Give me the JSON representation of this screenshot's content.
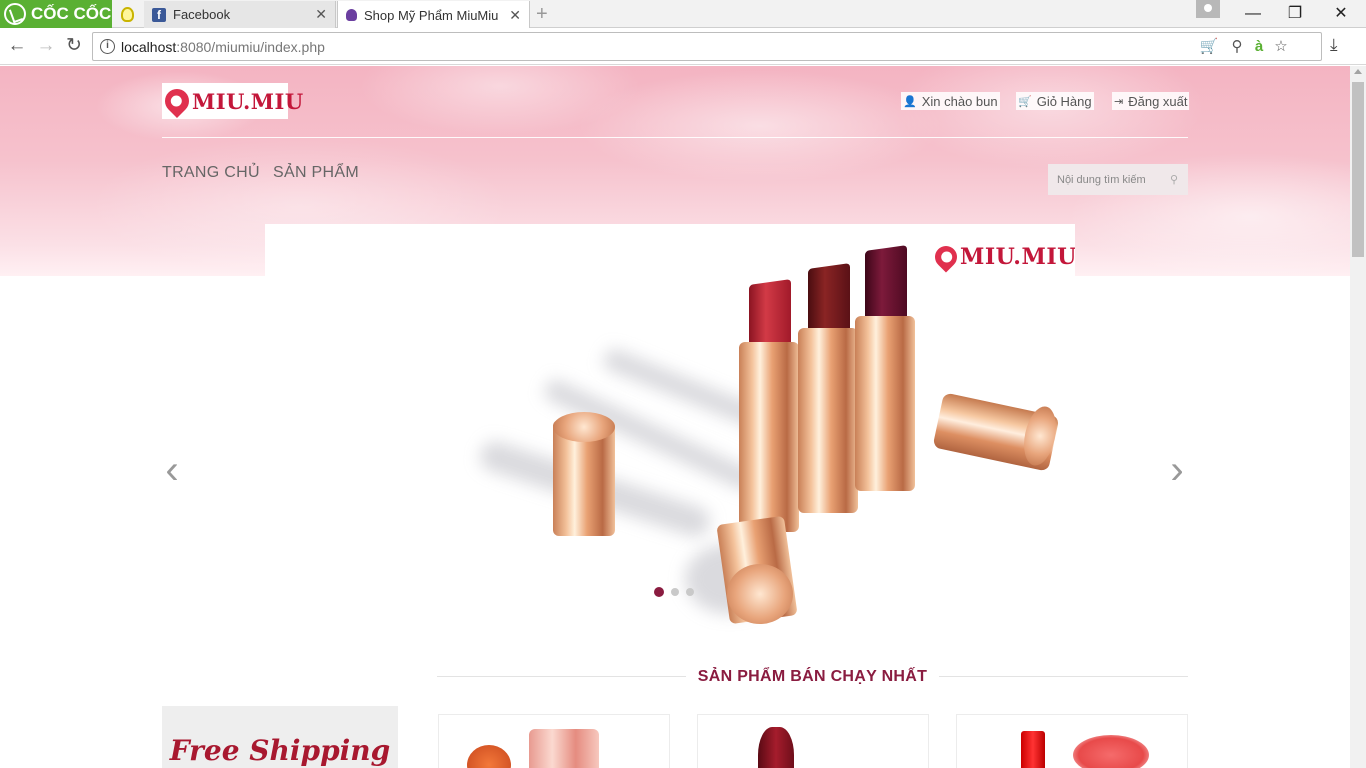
{
  "browser": {
    "brand": "CỐC CỐC",
    "tabs": [
      {
        "title": "Facebook",
        "active": false
      },
      {
        "title": "Shop Mỹ Phẩm MiuMiu",
        "active": true
      }
    ],
    "new_tab": "+",
    "url_host": "localhost",
    "url_rest": ":8080/miumiu/index.php",
    "window_controls": {
      "minimize": "—",
      "restore": "❐",
      "close": "✕"
    }
  },
  "site": {
    "logo_text": "MIU.MIU",
    "top_links": [
      {
        "icon": "user-icon",
        "label": "Xin chào bun"
      },
      {
        "icon": "cart-icon",
        "label": "Giỏ Hàng"
      },
      {
        "icon": "logout-icon",
        "label": "Đăng xuất"
      }
    ],
    "menu": [
      {
        "label": "TRANG CHỦ"
      },
      {
        "label": "SẢN PHẨM"
      }
    ],
    "search": {
      "placeholder": "Nội dung tìm kiếm"
    }
  },
  "slider": {
    "logo_text": "MIU.MIU",
    "prev": "‹",
    "next": "›",
    "slide_count": 3,
    "active_slide": 1
  },
  "best_seller": {
    "title": "SẢN PHẨM BÁN CHẠY NHẤT",
    "promo": "Free Shipping"
  },
  "colors": {
    "brand": "#8a1c40",
    "logo_red": "#c3173a",
    "coccoc_green": "#5ab033"
  }
}
